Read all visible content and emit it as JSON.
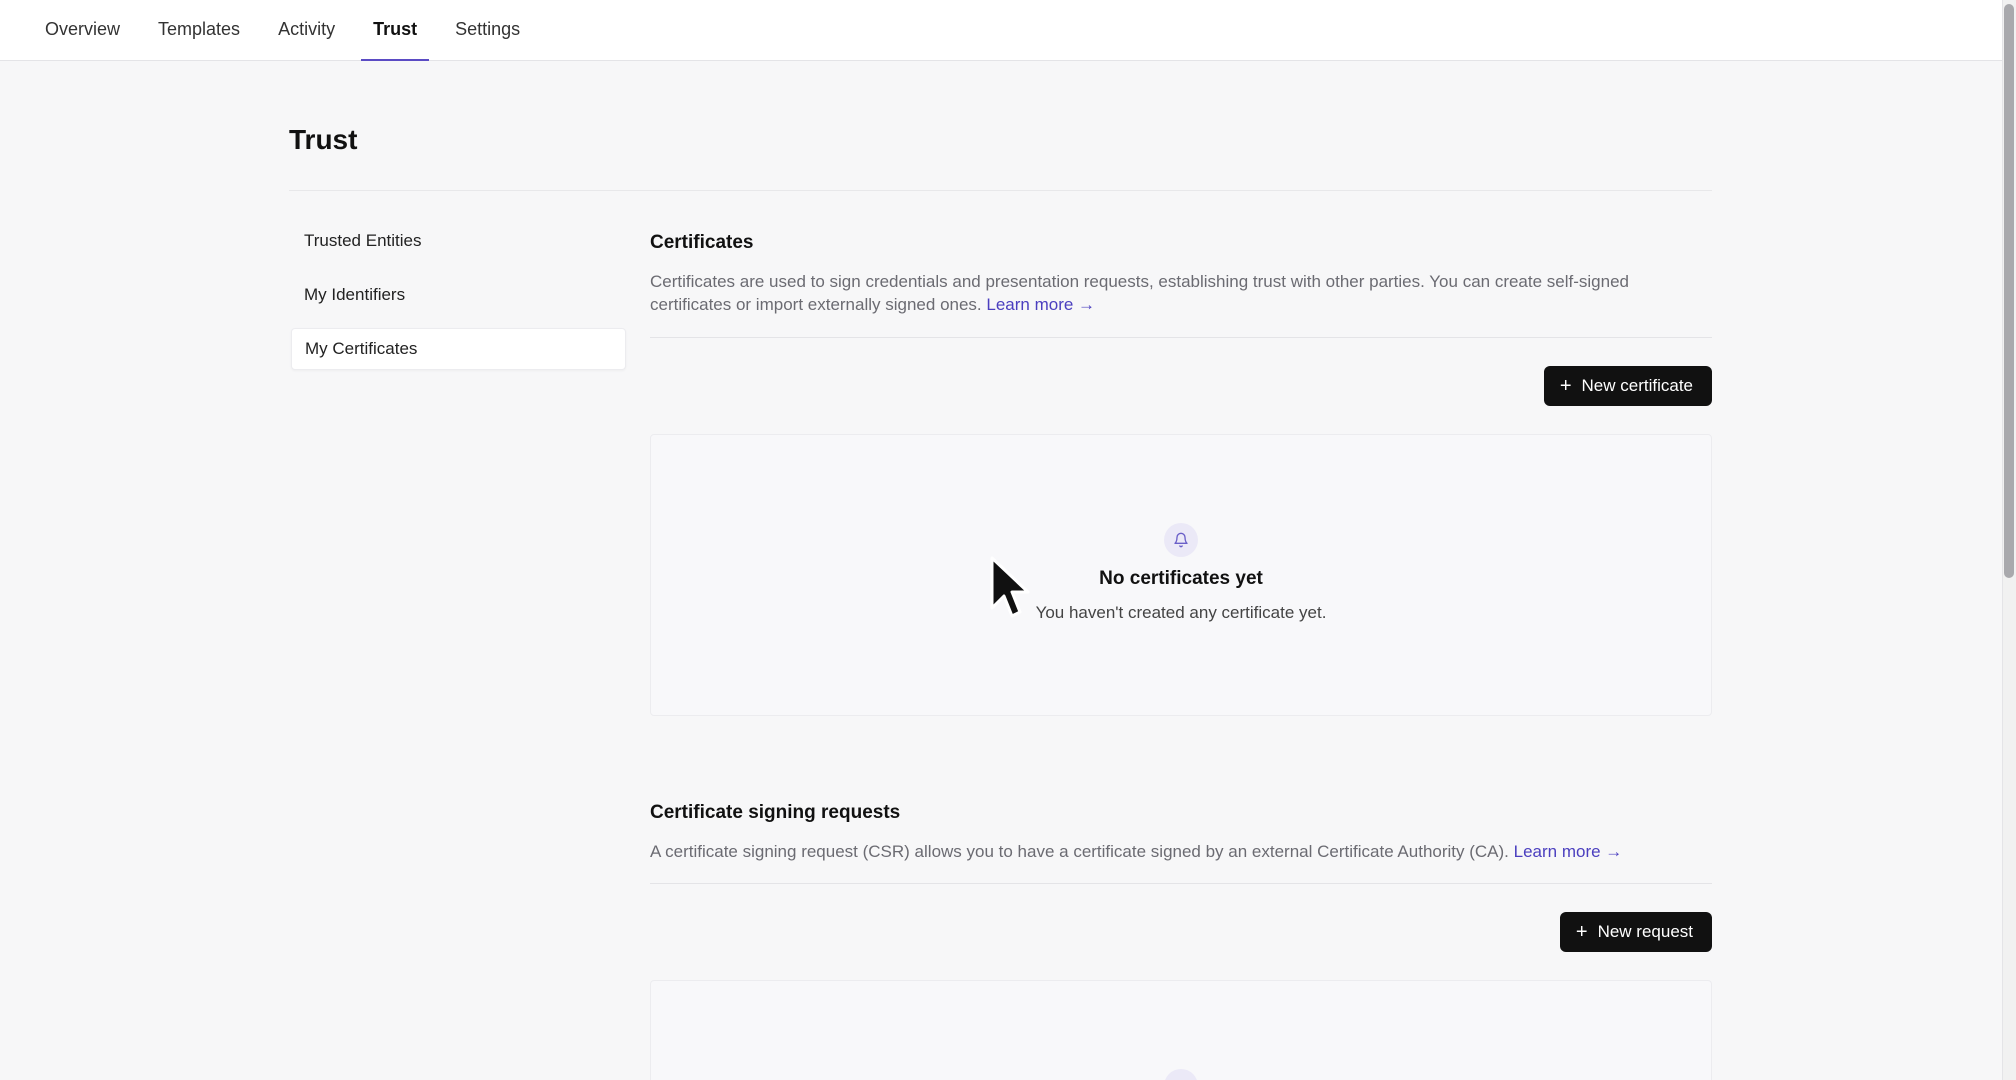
{
  "nav": {
    "tabs": [
      {
        "label": "Overview"
      },
      {
        "label": "Templates"
      },
      {
        "label": "Activity"
      },
      {
        "label": "Trust"
      },
      {
        "label": "Settings"
      }
    ],
    "active_tab": "Trust"
  },
  "page": {
    "title": "Trust"
  },
  "sidebar": {
    "items": [
      {
        "label": "Trusted Entities"
      },
      {
        "label": "My Identifiers"
      },
      {
        "label": "My Certificates"
      }
    ],
    "active_item": "My Certificates"
  },
  "certificates": {
    "title": "Certificates",
    "description": "Certificates are used to sign credentials and presentation requests, establishing trust with other parties. You can create self-signed certificates or import externally signed ones.",
    "learn_more": "Learn more →",
    "button_label": "New certificate",
    "empty_title": "No certificates yet",
    "empty_subtitle": "You haven't created any certificate yet."
  },
  "csr": {
    "title": "Certificate signing requests",
    "description": "A certificate signing request (CSR) allows you to have a certificate signed by an external Certificate Authority (CA).",
    "learn_more": "Learn more →",
    "button_label": "New request"
  },
  "icons": {
    "plus": "plus-icon",
    "bell": "bell-icon",
    "cursor": "mouse-pointer-icon"
  },
  "colors": {
    "accent": "#5b4bc4",
    "link": "#4b3fbf",
    "primary_button": "#111111",
    "background": "#f7f7f8"
  }
}
